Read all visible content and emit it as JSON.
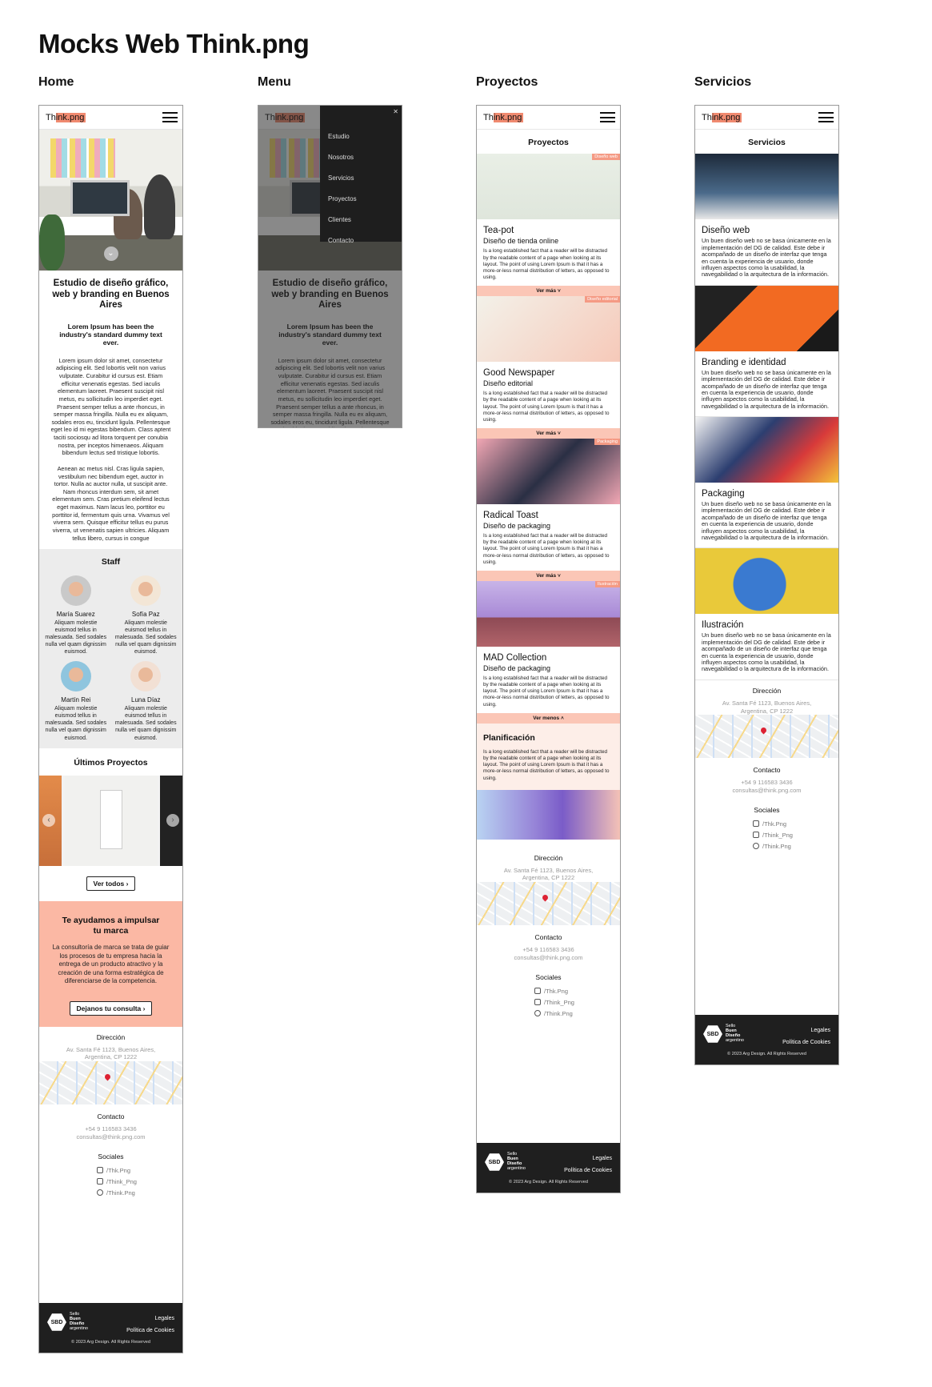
{
  "page_title": "Mocks Web Think.png",
  "frames": {
    "home": "Home",
    "menu": "Menu",
    "proyectos": "Proyectos",
    "servicios": "Servicios"
  },
  "logo": {
    "prefix": "Th",
    "rest": "ink.png"
  },
  "home": {
    "headline": "Estudio de diseño gráfico, web y branding en Buenos Aires",
    "subhead": "Lorem Ipsum has been the industry's standard dummy text ever.",
    "para1": "Lorem ipsum dolor sit amet, consectetur adipiscing elit. Sed lobortis velit non varius vulputate. Curabitur id cursus est. Etiam efficitur venenatis egestas. Sed iaculis elementum laoreet. Praesent suscipit nisl metus, eu sollicitudin leo imperdiet eget. Praesent semper tellus a ante rhoncus, in semper massa fringilla. Nulla eu ex aliquam, sodales eros eu, tincidunt ligula. Pellentesque eget leo id mi egestas bibendum. Class aptent taciti sociosqu ad litora torquent per conubia nostra, per inceptos himenaeos. Aliquam bibendum lectus sed tristique lobortis.",
    "para2": "Aenean ac metus nisl. Cras ligula sapien, vestibulum nec bibendum eget, auctor in tortor. Nulla ac auctor nulla, ut suscipit ante. Nam rhoncus interdum sem, sit amet elementum sem. Cras pretium eleifend lectus eget maximus. Nam lacus leo, porttitor eu porttitor id, fermentum quis urna. Vivamus vel viverra sem. Quisque efficitur tellus eu purus viverra, ut venenatis sapien ultricies. Aliquam tellus libero, cursus in congue",
    "staff_title": "Staff",
    "staff": [
      {
        "name": "María Suarez",
        "bio": "Aliquam molestie euismod tellus in malesuada. Sed sodales nulla vel quam dignissim euismod.",
        "color": "#c9c9c9"
      },
      {
        "name": "Sofía Paz",
        "bio": "Aliquam molestie euismod tellus in malesuada. Sed sodales nulla vel quam dignissim euismod.",
        "color": "#f3e6d6"
      },
      {
        "name": "Martín Rei",
        "bio": "Aliquam molestie euismod tellus in malesuada. Sed sodales nulla vel quam dignissim euismod.",
        "color": "#8fc5de"
      },
      {
        "name": "Luna Díaz",
        "bio": "Aliquam molestie euismod tellus in malesuada. Sed sodales nulla vel quam dignissim euismod.",
        "color": "#f2e0d4"
      }
    ],
    "projects_title": "Últimos Proyectos",
    "ver_todos": "Ver todos",
    "cta_title": "Te ayudamos a impulsar tu marca",
    "cta_body": "La consultoría de marca se trata de guiar los procesos de tu empresa hacia la entrega de un producto atractivo y la creación de una forma estratégica de diferenciarse de la competencia.",
    "cta_button": "Dejanos tu consulta"
  },
  "menu_items": [
    "Estudio",
    "Nosotros",
    "Servicios",
    "Proyectos",
    "Clientes",
    "Contacto"
  ],
  "proyectos": {
    "title": "Proyectos",
    "body": "Is a long established fact that a reader will be distracted by the readable content of a page when looking at its layout. The point of using Lorem Ipsum is that it has a more-or-less normal distribution of letters, as opposed to using.",
    "ver_mas": "Ver más",
    "ver_menos": "Ver menos",
    "items": [
      {
        "tag": "Diseño web",
        "title": "Tea-pot",
        "subtitle": "Diseño de tienda online"
      },
      {
        "tag": "Diseño editorial",
        "title": "Good Newspaper",
        "subtitle": "Diseño editorial"
      },
      {
        "tag": "Packaging",
        "title": "Radical Toast",
        "subtitle": "Diseño de packaging"
      },
      {
        "tag": "Ilustración",
        "title": "MAD Collection",
        "subtitle": "Diseño de packaging"
      }
    ],
    "planning_title": "Planificación"
  },
  "servicios": {
    "title": "Servicios",
    "body": "Un buen diseño web no se basa únicamente en la implementación del DG de calidad. Este debe ir acompañado de un diseño de interfaz que tenga en cuenta la experiencia de usuario, donde influyen aspectos como la usabilidad, la navegabilidad o la arquitectura de la información.",
    "items": [
      "Diseño web",
      "Branding e identidad",
      "Packaging",
      "Ilustración"
    ]
  },
  "footer": {
    "direccion_label": "Dirección",
    "direccion": "Av. Santa Fé 1123, Buenos Aires, Argentina, CP 1222",
    "contacto_label": "Contacto",
    "phone": "+54 9 116583 3436",
    "email": "consultas@think.png.com",
    "sociales_label": "Sociales",
    "linkedin": "/Thk.Png",
    "instagram": "/Think_Png",
    "facebook": "/Think.Png",
    "sbd_line1": "Sello",
    "sbd_line2": "Buen",
    "sbd_line3": "Diseño",
    "sbd_line4": "argentino",
    "sbd_mark": "SBD",
    "legales": "Legales",
    "cookies": "Política de Cookies",
    "copyright": "© 2023 Arg Design. All Rights Reserved"
  }
}
